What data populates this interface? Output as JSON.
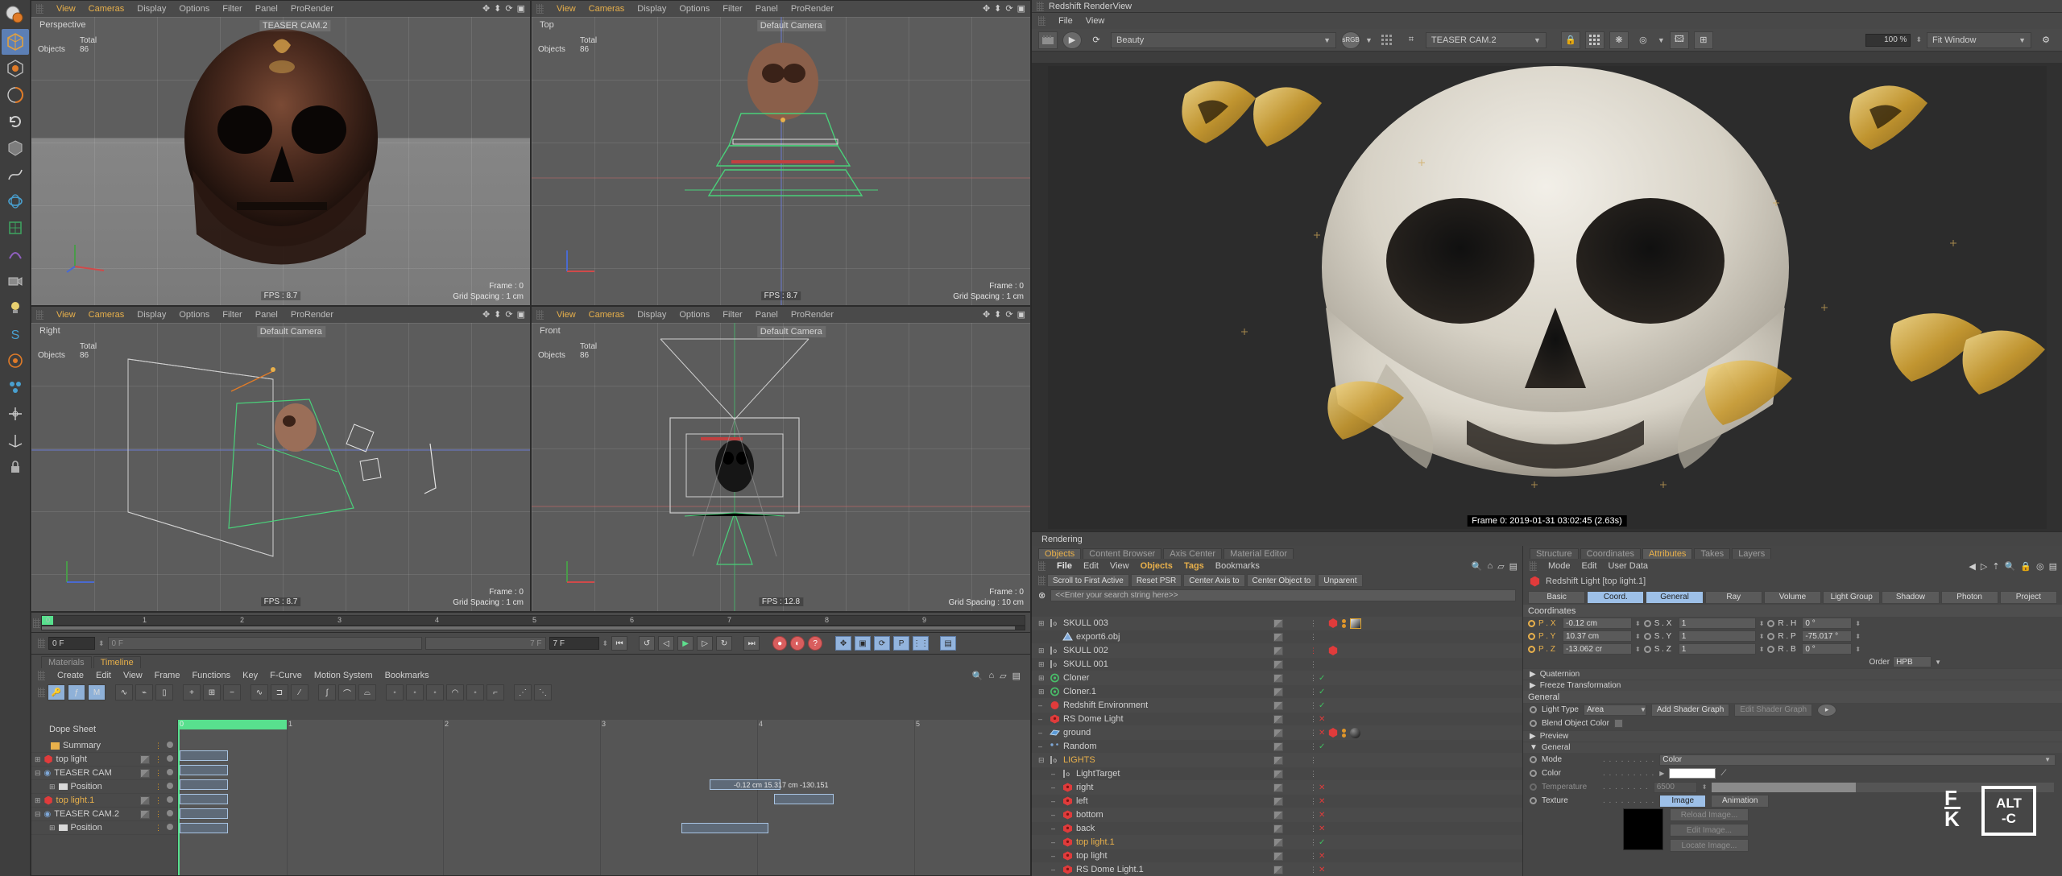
{
  "app": {
    "title": "Redshift RenderView"
  },
  "left_toolbar": {
    "icons": [
      "live-selection-icon",
      "move-icon",
      "scale-icon",
      "rotate-icon",
      "undo-icon",
      "cube-icon",
      "spline-icon",
      "nurbs-icon",
      "modeling-icon",
      "deformer-icon",
      "camera-icon",
      "light-icon",
      "s-icon",
      "render-icon",
      "mograph-icon",
      "snap-icon",
      "axis-icon",
      "lock-icon"
    ]
  },
  "viewports": [
    {
      "name": "perspective",
      "menu": [
        "View",
        "Cameras",
        "Display",
        "Options",
        "Filter",
        "Panel",
        "ProRender"
      ],
      "projection": "Perspective",
      "camera": "TEASER CAM.2",
      "stats_label": "Total",
      "stats_key": "Objects",
      "stats_value": "86",
      "fps": "FPS : 8.7",
      "frame": "Frame : 0",
      "grid": "Grid Spacing : 1 cm"
    },
    {
      "name": "top",
      "menu": [
        "View",
        "Cameras",
        "Display",
        "Options",
        "Filter",
        "Panel",
        "ProRender"
      ],
      "projection": "Top",
      "camera": "Default Camera",
      "stats_label": "Total",
      "stats_key": "Objects",
      "stats_value": "86",
      "fps": "FPS : 8.7",
      "frame": "Frame : 0",
      "grid": "Grid Spacing : 1 cm"
    },
    {
      "name": "right",
      "menu": [
        "View",
        "Cameras",
        "Display",
        "Options",
        "Filter",
        "Panel",
        "ProRender"
      ],
      "projection": "Right",
      "camera": "Default Camera",
      "stats_label": "Total",
      "stats_key": "Objects",
      "stats_value": "86",
      "fps": "FPS : 8.7",
      "frame": "Frame : 0",
      "grid": "Grid Spacing : 1 cm"
    },
    {
      "name": "front",
      "menu": [
        "View",
        "Cameras",
        "Display",
        "Options",
        "Filter",
        "Panel",
        "ProRender"
      ],
      "projection": "Front",
      "camera": "Default Camera",
      "stats_label": "Total",
      "stats_key": "Objects",
      "stats_value": "86",
      "fps": "FPS : 12.8",
      "frame": "Frame : 0",
      "grid": "Grid Spacing : 10 cm"
    }
  ],
  "timebar": {
    "ticks": [
      "0",
      "1",
      "2",
      "3",
      "4",
      "5",
      "6",
      "7",
      "8",
      "9"
    ]
  },
  "transport": {
    "range_ghost": "7 F",
    "range_value": "7 F",
    "current_frame": "0 F",
    "current_frame_ghost": "0 F",
    "buttons": [
      "go-to-start",
      "rewind",
      "step-back",
      "play",
      "step-forward",
      "loop",
      "go-to-end",
      "record",
      "autokey",
      "keyframe-selection"
    ],
    "toggles": [
      "position-key",
      "scale-key",
      "rotation-key",
      "param-key",
      "point-level-key",
      "anim-layer"
    ]
  },
  "timeline": {
    "tabs": [
      {
        "label": "Materials",
        "active": false
      },
      {
        "label": "Timeline",
        "active": true
      }
    ],
    "menu": [
      "Create",
      "Edit",
      "View",
      "Frame",
      "Functions",
      "Key",
      "F-Curve",
      "Motion System",
      "Bookmarks"
    ],
    "dope_title": "Dope Sheet",
    "rows": [
      {
        "label": "Summary",
        "highlight": false,
        "indent": 0,
        "has_key": true,
        "icon": "folder-icon"
      },
      {
        "label": "top light",
        "highlight": false,
        "indent": 0,
        "has_key": true,
        "icon": "light-icon"
      },
      {
        "label": "TEASER CAM",
        "highlight": false,
        "indent": 0,
        "has_key": true,
        "icon": "camera-icon"
      },
      {
        "label": "Position",
        "highlight": false,
        "indent": 1,
        "has_key": true,
        "icon": "track-icon"
      },
      {
        "label": "top light.1",
        "highlight": true,
        "indent": 0,
        "has_key": false,
        "icon": "light-icon"
      },
      {
        "label": "TEASER CAM.2",
        "highlight": false,
        "indent": 0,
        "has_key": true,
        "icon": "camera-icon"
      },
      {
        "label": "Position",
        "highlight": false,
        "indent": 1,
        "has_key": true,
        "icon": "track-icon"
      }
    ],
    "keyinfo": "-0.12 cm  15.317 cm  -130.151"
  },
  "renderview": {
    "title": "Redshift RenderView",
    "menu": [
      "File",
      "View"
    ],
    "aov": "Beauty",
    "camera": "TEASER CAM.2",
    "zoom": "100 %",
    "fit": "Fit Window",
    "frame_info": "Frame 0: 2019-01-31 03:02:45 (2.63s)",
    "icons": [
      "render-region-icon",
      "render-icon",
      "refresh-icon",
      "srgb-icon",
      "grid-icon",
      "crop-icon",
      "lock-icon",
      "grid2-icon",
      "snowflake-icon",
      "aperture-icon",
      "image-icon",
      "add-icon",
      "settings-icon"
    ]
  },
  "object_manager": {
    "section_label": "Rendering",
    "tabs": [
      {
        "label": "Objects",
        "active": true
      },
      {
        "label": "Content Browser",
        "active": false
      },
      {
        "label": "Axis Center",
        "active": false
      },
      {
        "label": "Material Editor",
        "active": false
      }
    ],
    "menu": [
      "File",
      "Edit",
      "View",
      "Objects",
      "Tags",
      "Bookmarks"
    ],
    "buttons": [
      "Scroll to First Active",
      "Reset PSR",
      "Center Axis to",
      "Center Object to",
      "Unparent"
    ],
    "search_placeholder": "<<Enter your search string here>>",
    "items": [
      {
        "label": "SKULL 003",
        "indent": 0,
        "icon": "layer-icon",
        "expand": "plus",
        "highlight": false,
        "visdot": "grey",
        "tag": true,
        "mats": [
          "red-hex",
          "orange-dots",
          "texture-thumb"
        ]
      },
      {
        "label": "export6.obj",
        "indent": 1,
        "icon": "poly-icon",
        "expand": "none",
        "highlight": false,
        "visdot": "grey",
        "tag": true,
        "mats": []
      },
      {
        "label": "SKULL 002",
        "indent": 0,
        "icon": "layer-icon",
        "expand": "plus",
        "highlight": false,
        "visdot": "red",
        "tag": true,
        "mats": [
          "red-hex"
        ]
      },
      {
        "label": "SKULL 001",
        "indent": 0,
        "icon": "layer-icon",
        "expand": "plus",
        "highlight": false,
        "visdot": "grey",
        "tag": true,
        "mats": []
      },
      {
        "label": "Cloner",
        "indent": 0,
        "icon": "cloner-icon",
        "expand": "plus",
        "highlight": false,
        "visdot": "check",
        "tag": true,
        "mats": []
      },
      {
        "label": "Cloner.1",
        "indent": 0,
        "icon": "cloner-icon",
        "expand": "plus",
        "highlight": false,
        "visdot": "check",
        "tag": true,
        "mats": []
      },
      {
        "label": "Redshift Environment",
        "indent": 0,
        "icon": "rs-env-icon",
        "expand": "dash",
        "highlight": false,
        "visdot": "check",
        "tag": true,
        "mats": []
      },
      {
        "label": "RS Dome Light",
        "indent": 0,
        "icon": "rs-light-icon",
        "expand": "dash",
        "highlight": false,
        "visdot": "cross",
        "tag": true,
        "mats": []
      },
      {
        "label": "ground",
        "indent": 0,
        "icon": "plane-icon",
        "expand": "dash",
        "highlight": false,
        "visdot": "cross",
        "tag": true,
        "mats": [
          "red-hex",
          "orange-dots",
          "sphere-thumb"
        ]
      },
      {
        "label": "Random",
        "indent": 0,
        "icon": "effector-icon",
        "expand": "dash",
        "highlight": false,
        "visdot": "check",
        "tag": true,
        "mats": []
      },
      {
        "label": "LIGHTS",
        "indent": 0,
        "icon": "layer-icon",
        "expand": "minus",
        "highlight": true,
        "visdot": "grey",
        "tag": true,
        "mats": []
      },
      {
        "label": "LightTarget",
        "indent": 1,
        "icon": "layer-icon",
        "expand": "dash",
        "highlight": false,
        "visdot": "grey",
        "tag": true,
        "mats": []
      },
      {
        "label": "right",
        "indent": 1,
        "icon": "rs-light-icon",
        "expand": "dash",
        "highlight": false,
        "visdot": "cross",
        "tag": true,
        "mats": []
      },
      {
        "label": "left",
        "indent": 1,
        "icon": "rs-light-icon",
        "expand": "dash",
        "highlight": false,
        "visdot": "cross",
        "tag": true,
        "mats": []
      },
      {
        "label": "bottom",
        "indent": 1,
        "icon": "rs-light-icon",
        "expand": "dash",
        "highlight": false,
        "visdot": "cross",
        "tag": true,
        "mats": []
      },
      {
        "label": "back",
        "indent": 1,
        "icon": "rs-light-icon",
        "expand": "dash",
        "highlight": false,
        "visdot": "cross",
        "tag": true,
        "mats": []
      },
      {
        "label": "top light.1",
        "indent": 1,
        "icon": "rs-light-icon",
        "expand": "dash",
        "highlight": true,
        "visdot": "check",
        "tag": true,
        "mats": []
      },
      {
        "label": "top light",
        "indent": 1,
        "icon": "rs-light-icon",
        "expand": "dash",
        "highlight": false,
        "visdot": "cross",
        "tag": true,
        "mats": []
      },
      {
        "label": "RS Dome Light.1",
        "indent": 1,
        "icon": "rs-light-icon",
        "expand": "dash",
        "highlight": false,
        "visdot": "cross",
        "tag": true,
        "mats": []
      }
    ]
  },
  "attributes": {
    "tabs": [
      {
        "label": "Structure",
        "active": false
      },
      {
        "label": "Coordinates",
        "active": false
      },
      {
        "label": "Attributes",
        "active": true
      },
      {
        "label": "Takes",
        "active": false
      },
      {
        "label": "Layers",
        "active": false
      }
    ],
    "menu": [
      "Mode",
      "Edit",
      "User Data"
    ],
    "object_title": "Redshift Light [top light.1]",
    "param_tabs": [
      {
        "label": "Basic",
        "active": false
      },
      {
        "label": "Coord.",
        "active": true
      },
      {
        "label": "General",
        "active": true
      },
      {
        "label": "Ray",
        "active": false
      },
      {
        "label": "Volume",
        "active": false
      },
      {
        "label": "Light Group",
        "active": false
      },
      {
        "label": "Shadow",
        "active": false
      },
      {
        "label": "Photon",
        "active": false
      },
      {
        "label": "Project",
        "active": false
      }
    ],
    "coord_header": "Coordinates",
    "coords": [
      {
        "p_label": "P . X",
        "p_value": "-0.12 cm",
        "s_label": "S . X",
        "s_value": "1",
        "r_label": "R . H",
        "r_value": "0 °"
      },
      {
        "p_label": "P . Y",
        "p_value": "10.37 cm",
        "s_label": "S . Y",
        "s_value": "1",
        "r_label": "R . P",
        "r_value": "-75.017 °"
      },
      {
        "p_label": "P . Z",
        "p_value": "-13.062 cr",
        "s_label": "S . Z",
        "s_value": "1",
        "r_label": "R . B",
        "r_value": "0 °"
      }
    ],
    "order_label": "Order",
    "order_value": "HPB",
    "folds": [
      "Quaternion",
      "Freeze Transformation"
    ],
    "general_header": "General",
    "light_type_label": "Light Type",
    "light_type_value": "Area",
    "add_shader_graph": "Add Shader Graph",
    "edit_shader_graph": "Edit Shader Graph",
    "blend_object_color": "Blend Object Color",
    "preview_fold": "Preview",
    "general_fold": "General",
    "mode_label": "Mode",
    "mode_value": "Color",
    "color_label": "Color",
    "color_value": "#ffffff",
    "temperature_label": "Temperature",
    "temperature_value": "6500",
    "texture_label": "Texture",
    "texture_tabs": [
      {
        "label": "Image",
        "active": true
      },
      {
        "label": "Animation",
        "active": false
      }
    ],
    "texture_buttons": [
      "Reload Image...",
      "Edit Image...",
      "Locate Image..."
    ]
  },
  "watermark": {
    "logo": "FK",
    "shortcut_top": "ALT",
    "shortcut_bottom": "-C"
  },
  "colors": {
    "accent": "#e8b04b",
    "select": "#9dc0e8",
    "green": "#58e08e",
    "red": "#e03b3b",
    "panel": "#4a4a4a"
  }
}
